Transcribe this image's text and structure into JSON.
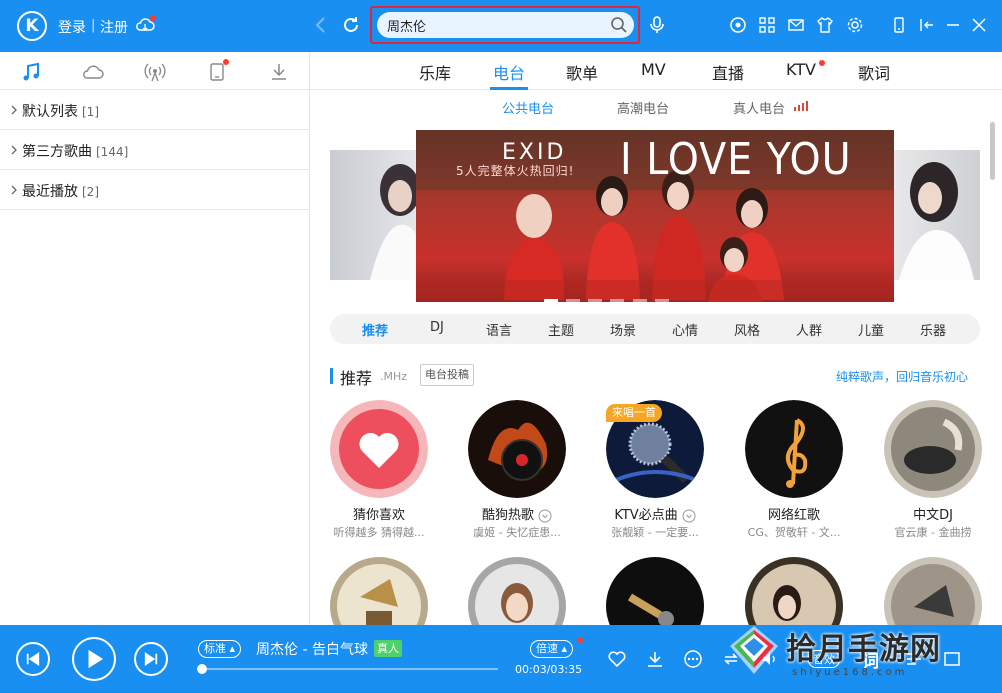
{
  "header": {
    "logo": "K",
    "login": "登录",
    "separator": "|",
    "register": "注册",
    "search": {
      "value": "周杰伦",
      "placeholder": ""
    }
  },
  "left_panel": {
    "tabs": [
      "music-note-icon",
      "cloud-icon",
      "radio-icon",
      "device-icon",
      "download-icon"
    ],
    "playlists": [
      {
        "name": "默认列表",
        "count": "[1]"
      },
      {
        "name": "第三方歌曲",
        "count": "[144]"
      },
      {
        "name": "最近播放",
        "count": "[2]"
      }
    ]
  },
  "main_nav": {
    "tabs": [
      "乐库",
      "电台",
      "歌单",
      "MV",
      "直播",
      "KTV",
      "歌词"
    ],
    "active": "电台"
  },
  "sub_tabs": [
    "公共电台",
    "高潮电台",
    "真人电台"
  ],
  "banner": {
    "brand": "EXID",
    "subtitle": "5人完整体火热回归!",
    "title": "I LOVE YOU"
  },
  "categories": [
    "推荐",
    "DJ",
    "语言",
    "主题",
    "场景",
    "心情",
    "风格",
    "人群",
    "儿童",
    "乐器"
  ],
  "section": {
    "title": "推荐",
    "unit": ".MHz",
    "submit_label": "电台投稿",
    "link": "纯粹歌声，回归音乐初心"
  },
  "stations": [
    {
      "name": "猜你喜欢",
      "desc": "听得越多 猜得越..."
    },
    {
      "name": "酷狗热歌",
      "desc": "虞姬 - 失忆症患..."
    },
    {
      "name": "KTV必点曲",
      "desc": "张靓颖 - 一定要...",
      "badge": "来唱一首"
    },
    {
      "name": "网络红歌",
      "desc": "CG、贺敬轩 - 文..."
    },
    {
      "name": "中文DJ",
      "desc": "官云康 - 金曲捞"
    }
  ],
  "player": {
    "quality": "标准",
    "song": "周杰伦 - 告白气球",
    "badge": "真人",
    "speed": "倍速",
    "time": "00:03/03:35",
    "progress": 0.014,
    "lyric": "词",
    "vol": "音效"
  },
  "watermark": {
    "title": "拾月手游网",
    "url": "shiyue168.com"
  },
  "colors": {
    "accent": "#1a8ff2",
    "badge_red": "#ff3b30",
    "highlight_outline": "#e0253d"
  }
}
